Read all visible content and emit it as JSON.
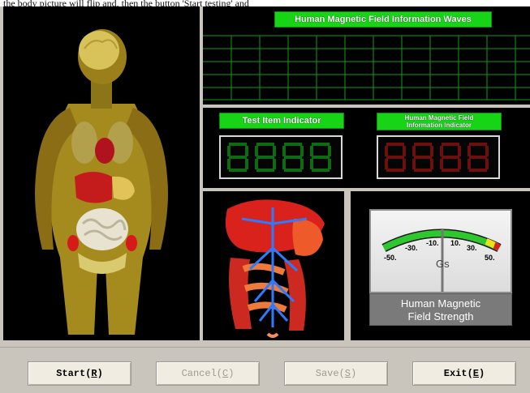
{
  "header": {
    "cut_text": "the body picture will flip and, then the button 'Start testing' and"
  },
  "waves": {
    "title": "Human Magnetic Field Information Waves"
  },
  "indicators": {
    "test_item": {
      "label": "Test Item Indicator"
    },
    "magnetic_field": {
      "label_line1": "Human Magnetic Field",
      "label_line2": "Information Indicator"
    }
  },
  "meter": {
    "ticks": [
      "-50.",
      "-30.",
      "-10.",
      "10.",
      "30.",
      "50."
    ],
    "unit": "Gs",
    "caption_line1": "Human Magnetic",
    "caption_line2": "Field Strength",
    "needle_value": 0
  },
  "buttons": {
    "start": {
      "text": "Start(",
      "key": "R",
      "end": ")"
    },
    "cancel": {
      "text": "Cancel(",
      "key": "C",
      "end": ")"
    },
    "save": {
      "text": "Save(",
      "key": "S",
      "end": ")"
    },
    "exit": {
      "text": "Exit(",
      "key": "E",
      "end": ")"
    }
  },
  "colors": {
    "label_green": "#17d417",
    "grid_green": "#0f9b1f",
    "digit_green": "#0f6b13",
    "digit_red": "#6b0f0f"
  }
}
